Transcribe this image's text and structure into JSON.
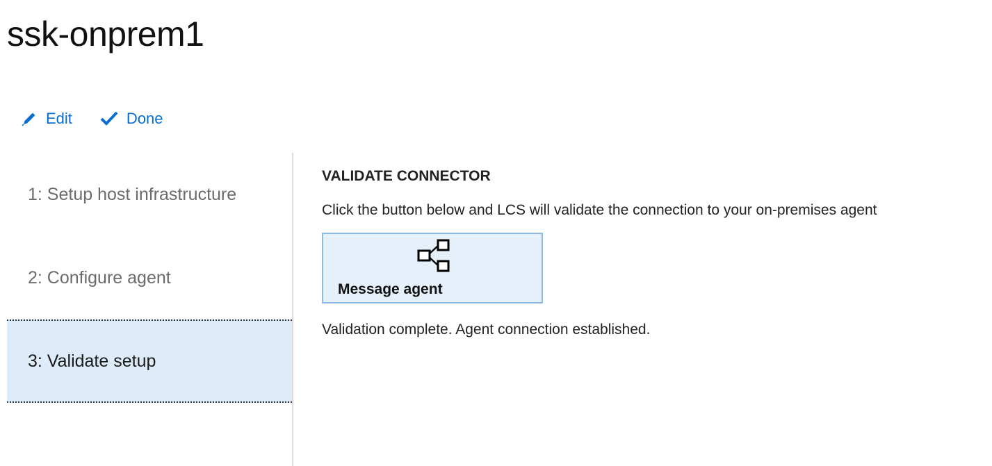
{
  "header": {
    "title": "ssk-onprem1"
  },
  "toolbar": {
    "edit_label": "Edit",
    "done_label": "Done"
  },
  "colors": {
    "accent": "#0a6ed1",
    "selected_bg": "#deebf8",
    "button_bg": "#e6f0fa",
    "button_border": "#8dbbe6"
  },
  "steps": [
    {
      "label": "1: Setup host infrastructure",
      "selected": false
    },
    {
      "label": "2: Configure agent",
      "selected": false
    },
    {
      "label": "3: Validate setup",
      "selected": true
    }
  ],
  "main": {
    "heading": "VALIDATE CONNECTOR",
    "description": "Click the button below and LCS will validate the connection to your on-premises agent",
    "button_label": "Message agent",
    "button_icon": "hierarchy-icon",
    "status": "Validation complete. Agent connection established."
  }
}
